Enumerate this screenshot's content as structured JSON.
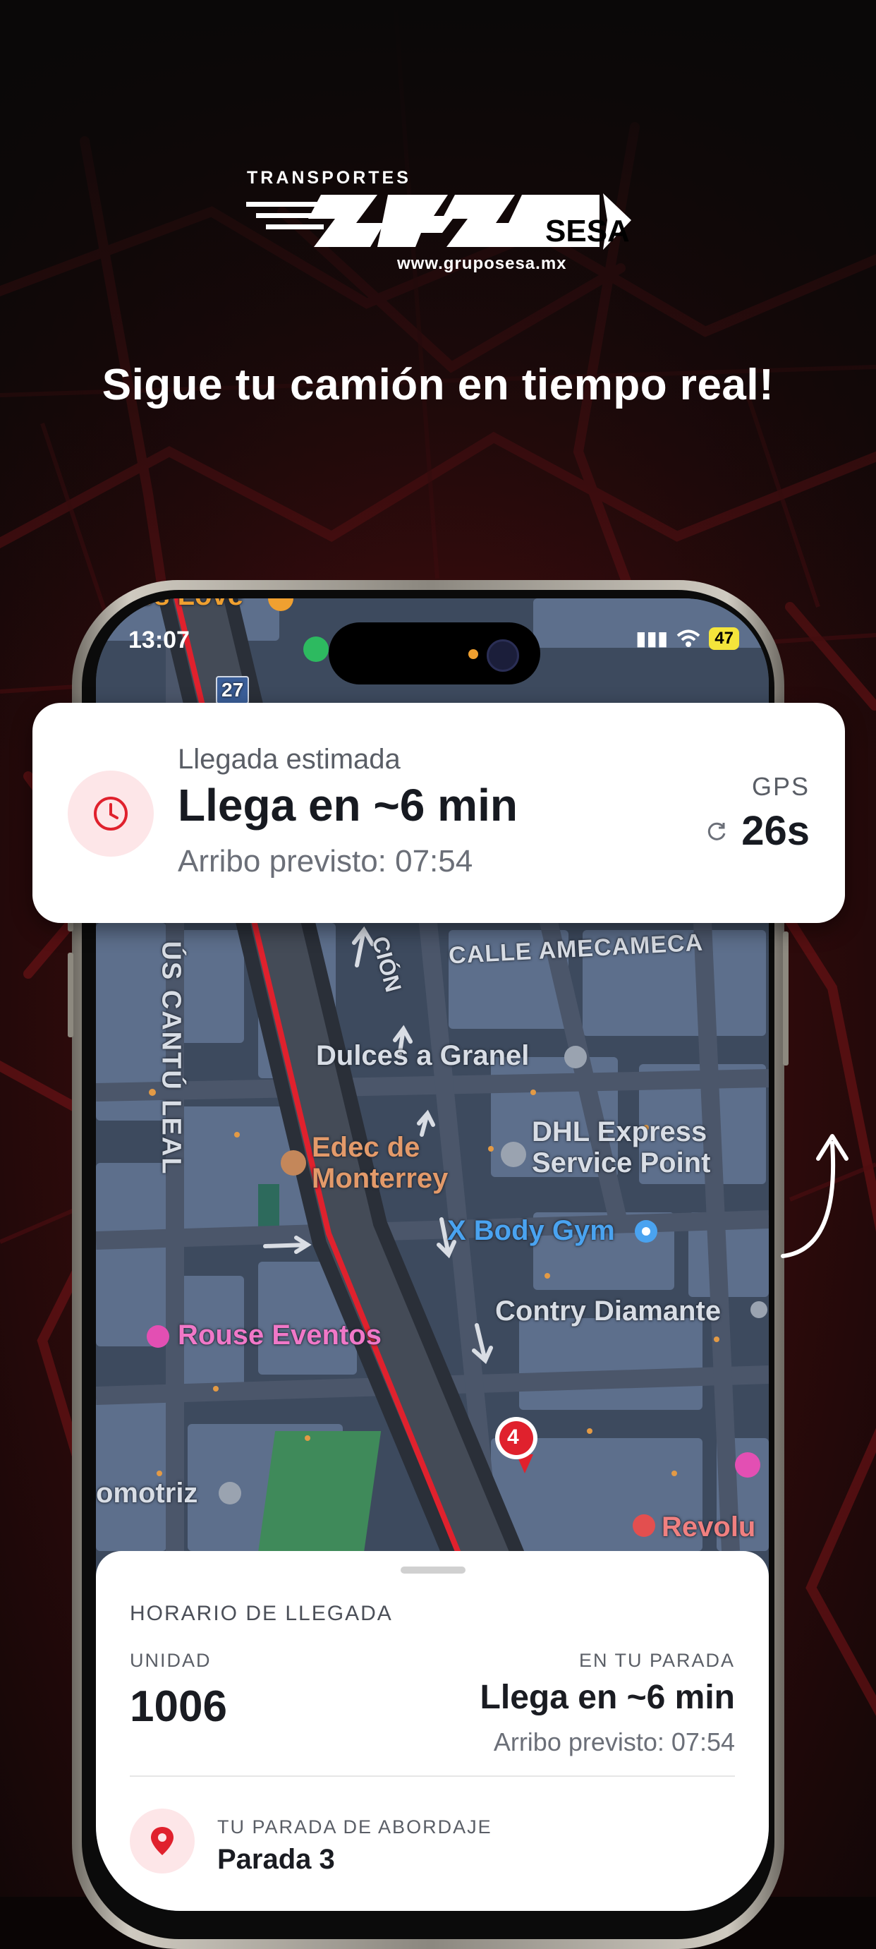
{
  "brand": {
    "top_text": "TRANSPORTES",
    "wordmark": "SESA",
    "url": "www.gruposesa.mx"
  },
  "headline": "Sigue tu camión en tiempo real!",
  "status_bar": {
    "time": "13:07",
    "battery": "47"
  },
  "map": {
    "labels": {
      "top_fragment": "es Love",
      "road_badge": "27",
      "street_vertical": "ÚS CANTÚ LEAL",
      "street_cion": "CIÓN",
      "street_amecameca": "CALLE AMECAMECA",
      "poi_dulces": "Dulces a Granel",
      "poi_edec_1": "Edec de",
      "poi_edec_2": "Monterrey",
      "poi_dhl_1": "DHL Express",
      "poi_dhl_2": "Service Point",
      "poi_gym": "X Body Gym",
      "poi_contry": "Contry Diamante",
      "poi_rouse": "Rouse Eventos",
      "poi_automotriz": "omotriz",
      "poi_revolu": "Revolu",
      "bus_marker": "4"
    },
    "colors": {
      "route": "#e0212d",
      "accent": "#e0212d"
    }
  },
  "eta_card": {
    "label": "Llegada estimada",
    "title": "Llega en ~6 min",
    "arrival": "Arribo previsto: 07:54",
    "gps_label": "GPS",
    "gps_value": "26s",
    "icon": "clock-icon"
  },
  "sheet": {
    "heading": "HORARIO DE LLEGADA",
    "unit_label": "UNIDAD",
    "unit_value": "1006",
    "stop_label": "EN TU PARADA",
    "stop_eta": "Llega en ~6 min",
    "stop_arrival": "Arribo previsto: 07:54",
    "boarding_label": "TU PARADA DE ABORDAJE",
    "boarding_value": "Parada 3",
    "icon": "location-pin-icon"
  }
}
